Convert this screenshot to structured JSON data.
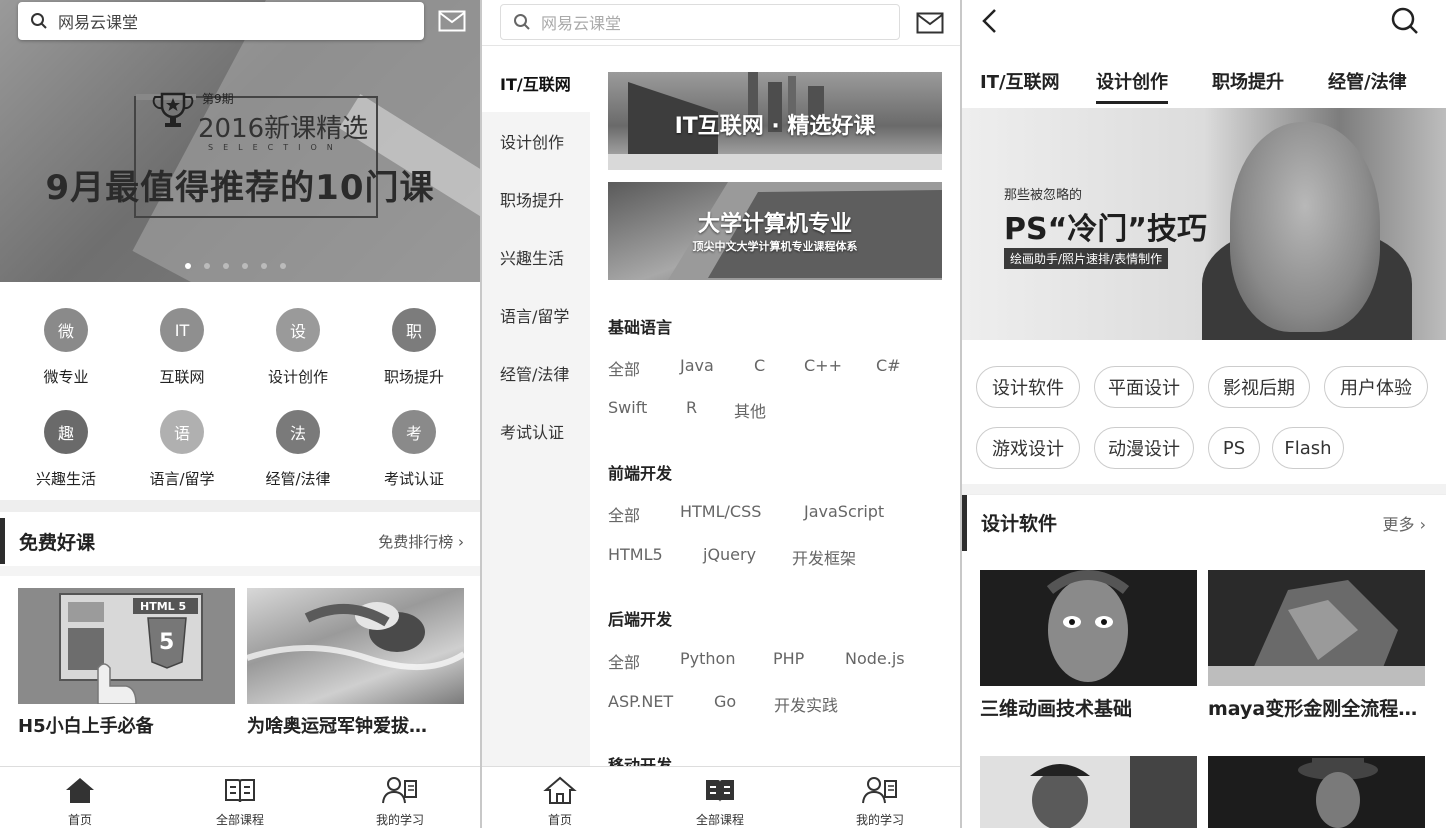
{
  "panel1": {
    "search_placeholder": "网易云课堂",
    "banner": {
      "issue": "第9期",
      "year_title": "2016新课精选",
      "selection": "SELECTION",
      "headline": "9月最值得推荐的10门课"
    },
    "categories": [
      {
        "icon_char": "微",
        "label": "微专业",
        "color": "#8a8a8a"
      },
      {
        "icon_char": "IT",
        "label": "互联网",
        "color": "#8f8f8f"
      },
      {
        "icon_char": "设",
        "label": "设计创作",
        "color": "#9a9a9a"
      },
      {
        "icon_char": "职",
        "label": "职场提升",
        "color": "#7c7c7c"
      },
      {
        "icon_char": "趣",
        "label": "兴趣生活",
        "color": "#6a6a6a"
      },
      {
        "icon_char": "语",
        "label": "语言/留学",
        "color": "#b0b0b0"
      },
      {
        "icon_char": "法",
        "label": "经管/法律",
        "color": "#7a7a7a"
      },
      {
        "icon_char": "考",
        "label": "考试认证",
        "color": "#8a8a8a"
      }
    ],
    "section": {
      "title": "免费好课",
      "more": "免费排行榜"
    },
    "cards": [
      {
        "badge": "HTML 5",
        "title": "H5小白上手必备"
      },
      {
        "title": "为啥奥运冠军钟爱拔…"
      }
    ]
  },
  "panel2": {
    "search_placeholder": "网易云课堂",
    "sidebar": [
      "IT/互联网",
      "设计创作",
      "职场提升",
      "兴趣生活",
      "语言/留学",
      "经管/法律",
      "考试认证"
    ],
    "images": [
      {
        "caption": "IT互联网 · 精选好课"
      },
      {
        "caption": "大学计算机专业",
        "sub": "顶尖中文大学计算机专业课程体系"
      }
    ],
    "groups": [
      {
        "title": "基础语言",
        "rows": [
          [
            "全部",
            "Java",
            "C",
            "C++",
            "C#"
          ],
          [
            "Swift",
            "R",
            "其他"
          ]
        ]
      },
      {
        "title": "前端开发",
        "rows": [
          [
            "全部",
            "HTML/CSS",
            "JavaScript"
          ],
          [
            "HTML5",
            "jQuery",
            "开发框架"
          ]
        ]
      },
      {
        "title": "后端开发",
        "rows": [
          [
            "全部",
            "Python",
            "PHP",
            "Node.js"
          ],
          [
            "ASP.NET",
            "Go",
            "开发实践"
          ]
        ]
      },
      {
        "title": "移动开发"
      }
    ]
  },
  "panel3": {
    "tabs": [
      "IT/互联网",
      "设计创作",
      "职场提升",
      "经管/法律"
    ],
    "banner": {
      "sub": "那些被忽略的",
      "title": "PS“冷门”技巧",
      "tagline": "绘画助手/照片速排/表情制作"
    },
    "pills": [
      [
        "设计软件",
        "平面设计",
        "影视后期",
        "用户体验"
      ],
      [
        "游戏设计",
        "动漫设计",
        "PS",
        "Flash"
      ]
    ],
    "section": {
      "title": "设计软件",
      "more": "更多"
    },
    "cards": [
      {
        "title": "三维动画技术基础"
      },
      {
        "title": "maya变形金刚全流程…"
      }
    ]
  },
  "tabbar": [
    {
      "label": "首页",
      "icon": "home-icon"
    },
    {
      "label": "全部课程",
      "icon": "book-icon"
    },
    {
      "label": "我的学习",
      "icon": "user-study-icon"
    }
  ]
}
